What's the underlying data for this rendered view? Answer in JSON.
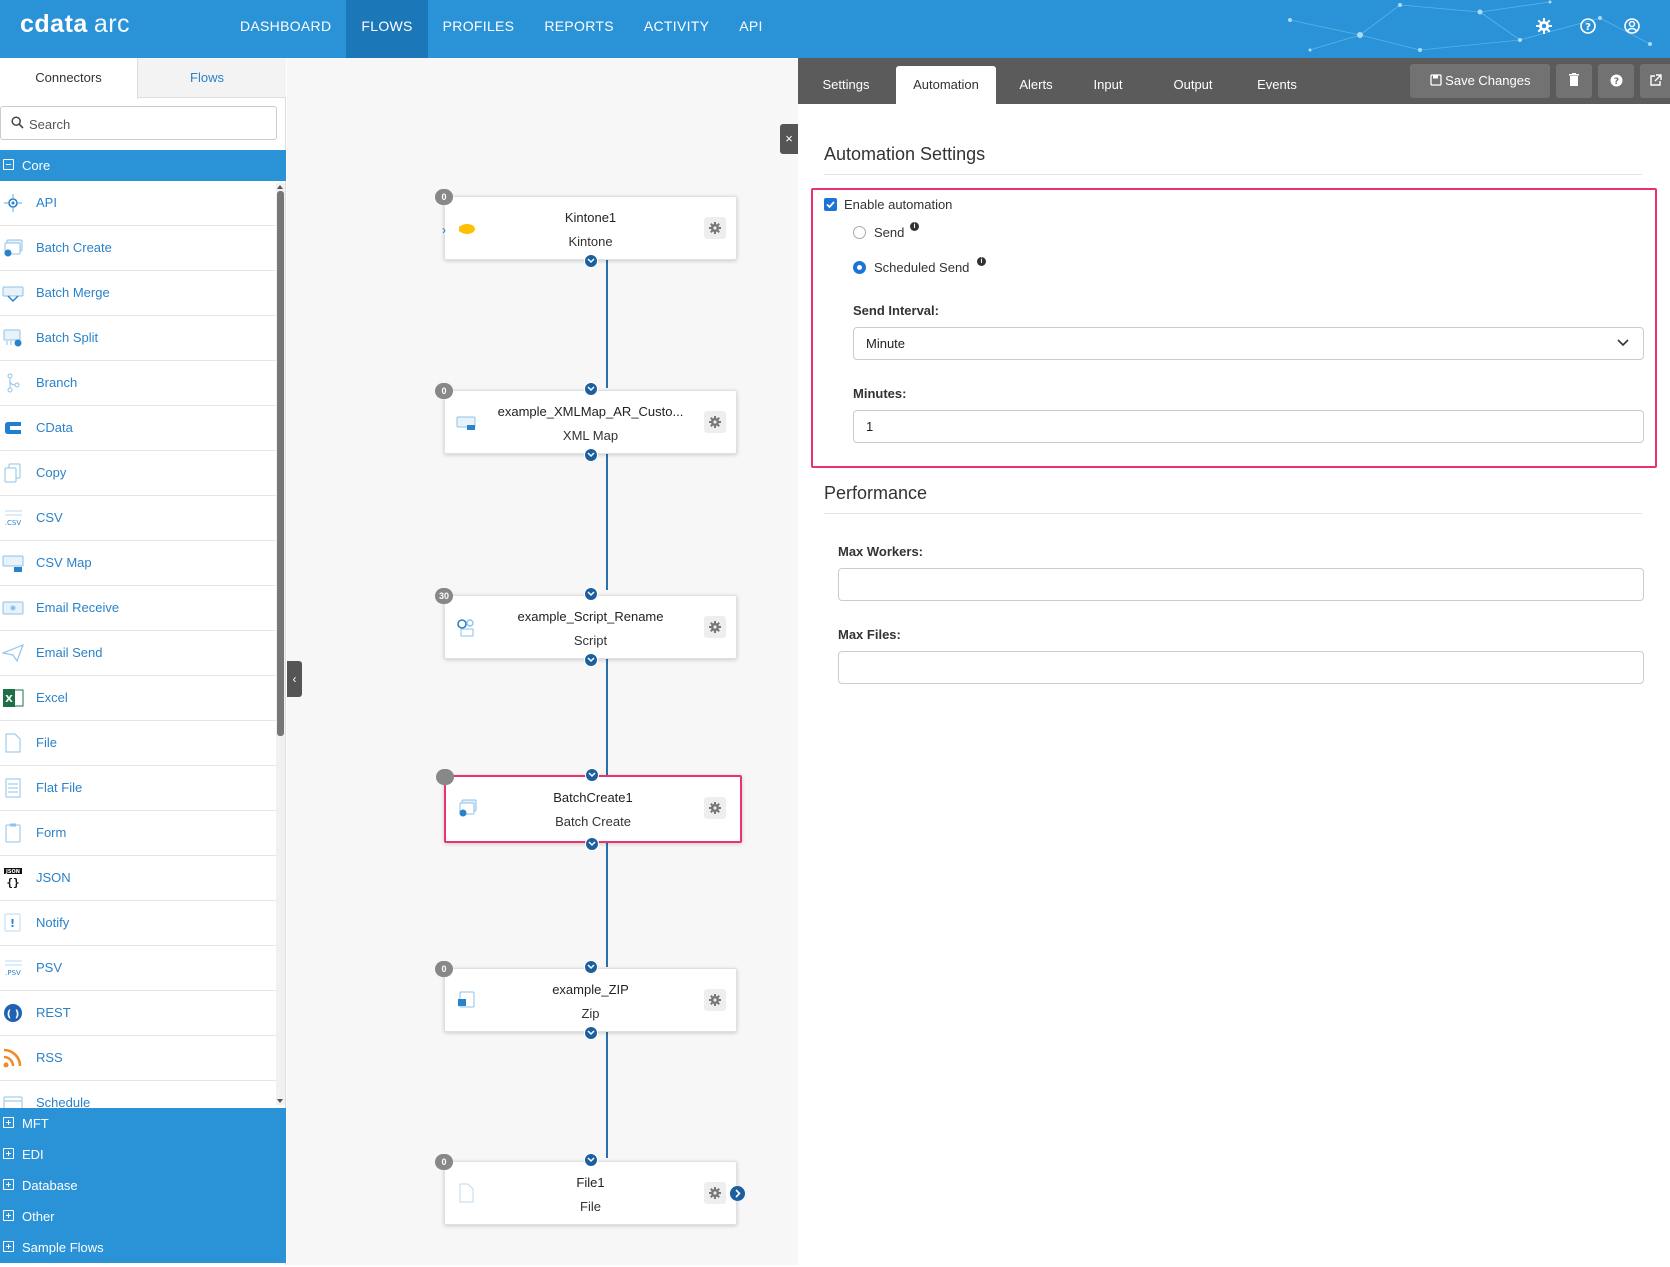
{
  "app": {
    "logo_main": "cdata",
    "logo_sub": "arc"
  },
  "nav": [
    {
      "label": "DASHBOARD",
      "active": false
    },
    {
      "label": "FLOWS",
      "active": true
    },
    {
      "label": "PROFILES",
      "active": false
    },
    {
      "label": "REPORTS",
      "active": false
    },
    {
      "label": "ACTIVITY",
      "active": false
    },
    {
      "label": "API",
      "active": false
    }
  ],
  "top_icons": [
    "gear-icon",
    "help-icon",
    "user-icon"
  ],
  "sidebar": {
    "tabs": [
      {
        "label": "Connectors",
        "active": true
      },
      {
        "label": "Flows",
        "active": false
      }
    ],
    "search_placeholder": "Search",
    "core_group": "Core",
    "core_items": [
      {
        "label": "API",
        "icon": "api-icon"
      },
      {
        "label": "Batch Create",
        "icon": "batch-create-icon"
      },
      {
        "label": "Batch Merge",
        "icon": "batch-merge-icon"
      },
      {
        "label": "Batch Split",
        "icon": "batch-split-icon"
      },
      {
        "label": "Branch",
        "icon": "branch-icon"
      },
      {
        "label": "CData",
        "icon": "cdata-icon"
      },
      {
        "label": "Copy",
        "icon": "copy-icon"
      },
      {
        "label": "CSV",
        "icon": "csv-icon"
      },
      {
        "label": "CSV Map",
        "icon": "csv-map-icon"
      },
      {
        "label": "Email Receive",
        "icon": "email-receive-icon"
      },
      {
        "label": "Email Send",
        "icon": "email-send-icon"
      },
      {
        "label": "Excel",
        "icon": "excel-icon"
      },
      {
        "label": "File",
        "icon": "file-icon"
      },
      {
        "label": "Flat File",
        "icon": "flat-file-icon"
      },
      {
        "label": "Form",
        "icon": "form-icon"
      },
      {
        "label": "JSON",
        "icon": "json-icon"
      },
      {
        "label": "Notify",
        "icon": "notify-icon"
      },
      {
        "label": "PSV",
        "icon": "psv-icon"
      },
      {
        "label": "REST",
        "icon": "rest-icon"
      },
      {
        "label": "RSS",
        "icon": "rss-icon"
      },
      {
        "label": "Schedule",
        "icon": "schedule-icon"
      }
    ],
    "other_groups": [
      "MFT",
      "EDI",
      "Database",
      "Other",
      "Sample Flows"
    ]
  },
  "flow": {
    "nodes": [
      {
        "title": "Kintone1",
        "type": "Kintone",
        "badge": "0",
        "icon": "kintone-icon",
        "selected": false
      },
      {
        "title": "example_XMLMap_AR_Custo...",
        "type": "XML Map",
        "badge": "0",
        "icon": "xml-map-icon",
        "selected": false
      },
      {
        "title": "example_Script_Rename",
        "type": "Script",
        "badge": "30",
        "icon": "script-icon",
        "selected": false
      },
      {
        "title": "BatchCreate1",
        "type": "Batch Create",
        "badge": "",
        "icon": "batch-create-icon",
        "selected": true
      },
      {
        "title": "example_ZIP",
        "type": "Zip",
        "badge": "0",
        "icon": "zip-icon",
        "selected": false
      },
      {
        "title": "File1",
        "type": "File",
        "badge": "0",
        "icon": "file-icon",
        "selected": false
      }
    ]
  },
  "panel": {
    "tabs": [
      {
        "label": "Settings",
        "active": false
      },
      {
        "label": "Automation",
        "active": true
      },
      {
        "label": "Alerts",
        "active": false
      },
      {
        "label": "Input",
        "active": false
      },
      {
        "label": "Output",
        "active": false
      },
      {
        "label": "Events",
        "active": false
      }
    ],
    "save_label": "Save Changes",
    "automation": {
      "title": "Automation Settings",
      "enable_label": "Enable automation",
      "enabled": true,
      "send_label": "Send",
      "scheduled_label": "Scheduled Send",
      "selected_mode": "Scheduled Send",
      "interval_label": "Send Interval:",
      "interval_value": "Minute",
      "minutes_label": "Minutes:",
      "minutes_value": "1"
    },
    "performance": {
      "title": "Performance",
      "workers_label": "Max Workers:",
      "workers_value": "",
      "files_label": "Max Files:",
      "files_value": ""
    }
  },
  "colors": {
    "brand": "#2a93d8",
    "nav_active": "#1b77b8",
    "link": "#2a82c9",
    "highlight": "#e8336d",
    "port": "#1b5f9e"
  }
}
